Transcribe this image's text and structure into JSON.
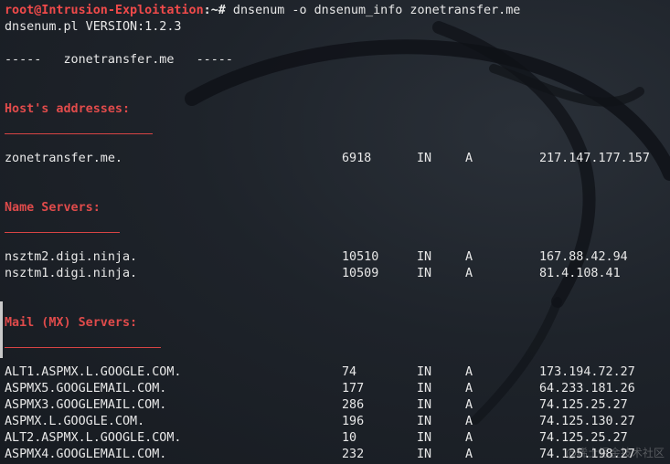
{
  "prompt": {
    "user_host": "root@Intrusion-Exploitation",
    "path_symbol": ":~#",
    "command": " dnsenum -o dnsenum_info zonetransfer.me"
  },
  "version_line": "dnsenum.pl VERSION:1.2.3",
  "domain_banner": "-----   zonetransfer.me   -----",
  "sections": {
    "hosts": {
      "title": "Host's addresses:",
      "underline": "__________________",
      "rows": [
        {
          "host": "zonetransfer.me.",
          "ttl": "6918",
          "class": "IN",
          "type": "A",
          "ip": "217.147.177.157"
        }
      ]
    },
    "ns": {
      "title": "Name Servers:",
      "underline": "______________",
      "rows": [
        {
          "host": "nsztm2.digi.ninja.",
          "ttl": "10510",
          "class": "IN",
          "type": "A",
          "ip": "167.88.42.94"
        },
        {
          "host": "nsztm1.digi.ninja.",
          "ttl": "10509",
          "class": "IN",
          "type": "A",
          "ip": "81.4.108.41"
        }
      ]
    },
    "mx": {
      "title": "Mail (MX) Servers:",
      "underline": "___________________",
      "rows": [
        {
          "host": "ALT1.ASPMX.L.GOOGLE.COM.",
          "ttl": "74",
          "class": "IN",
          "type": "A",
          "ip": "173.194.72.27"
        },
        {
          "host": "ASPMX5.GOOGLEMAIL.COM.",
          "ttl": "177",
          "class": "IN",
          "type": "A",
          "ip": "64.233.181.26"
        },
        {
          "host": "ASPMX3.GOOGLEMAIL.COM.",
          "ttl": "286",
          "class": "IN",
          "type": "A",
          "ip": "74.125.25.27"
        },
        {
          "host": "ASPMX.L.GOOGLE.COM.",
          "ttl": "196",
          "class": "IN",
          "type": "A",
          "ip": "74.125.130.27"
        },
        {
          "host": "ALT2.ASPMX.L.GOOGLE.COM.",
          "ttl": "10",
          "class": "IN",
          "type": "A",
          "ip": "74.125.25.27"
        },
        {
          "host": "ASPMX4.GOOGLEMAIL.COM.",
          "ttl": "232",
          "class": "IN",
          "type": "A",
          "ip": "74.125.198.27"
        }
      ]
    }
  },
  "watermark": "@稀土掘金技术社区",
  "colors": {
    "background": "#1e232a",
    "prompt_red": "#f04a4a",
    "section_red": "#e04b4b",
    "text": "#e8e8e8"
  }
}
